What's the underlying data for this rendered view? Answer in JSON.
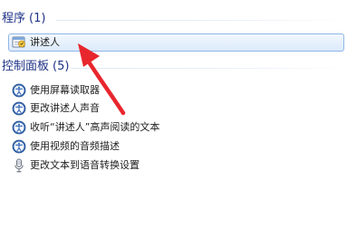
{
  "programs": {
    "title": "程序",
    "count": "(1)",
    "items": [
      {
        "label": "讲述人",
        "icon": "narrator-app-icon"
      }
    ]
  },
  "control_panel": {
    "title": "控制面板",
    "count": "(5)",
    "items": [
      {
        "label": "使用屏幕读取器",
        "icon": "ease-of-access-icon"
      },
      {
        "label": "更改讲述人声音",
        "icon": "ease-of-access-icon"
      },
      {
        "label": "收听“讲述人”高声阅读的文本",
        "icon": "ease-of-access-icon"
      },
      {
        "label": "使用视频的音频描述",
        "icon": "ease-of-access-icon"
      },
      {
        "label": "更改文本到语音转换设置",
        "icon": "microphone-icon"
      }
    ]
  },
  "annotation": {
    "arrow_color": "#e8262d"
  },
  "colors": {
    "header": "#1e3287",
    "selection_border": "#8fb6e6",
    "ease_of_access_blue": "#3d6fb8"
  }
}
